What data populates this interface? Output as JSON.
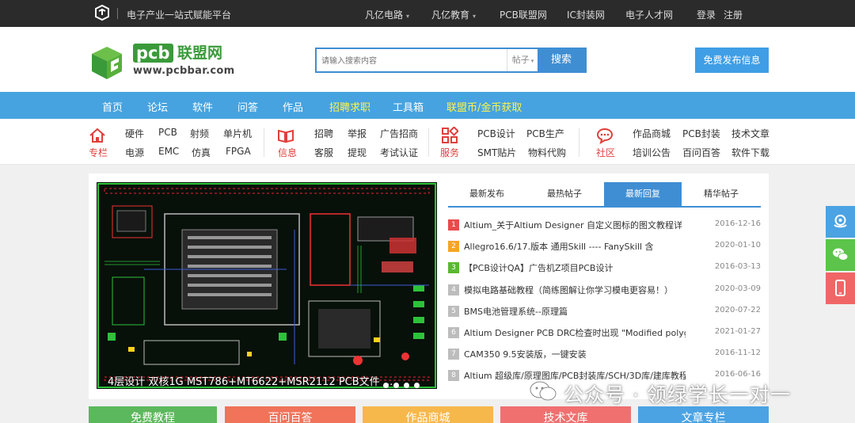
{
  "topbar": {
    "tagline": "电子产业一站式赋能平台",
    "nav": [
      {
        "label": "凡亿电路",
        "caret": "▾"
      },
      {
        "label": "凡亿教育",
        "caret": "▾"
      },
      {
        "label": "PCB联盟网",
        "caret": ""
      },
      {
        "label": "IC封装网",
        "caret": ""
      },
      {
        "label": "电子人才网",
        "caret": ""
      }
    ],
    "login": "登录",
    "register": "注册"
  },
  "header": {
    "logo_pcb": "pcb",
    "logo_name": "联盟网",
    "logo_url": "www.pcbbar.com",
    "search_placeholder": "请输入搜索内容",
    "search_type": "帖子",
    "search_button": "搜索",
    "publish_button": "免费发布信息"
  },
  "mainnav": [
    {
      "label": "首页",
      "highlight": false
    },
    {
      "label": "论坛",
      "highlight": false
    },
    {
      "label": "软件",
      "highlight": false
    },
    {
      "label": "问答",
      "highlight": false
    },
    {
      "label": "作品",
      "highlight": false
    },
    {
      "label": "招聘求职",
      "highlight": true
    },
    {
      "label": "工具箱",
      "highlight": false
    },
    {
      "label": "联盟币/金币获取",
      "highlight": true
    }
  ],
  "categories": [
    {
      "label": "专栏",
      "icon": "home-icon",
      "links": [
        "硬件",
        "PCB",
        "射频",
        "单片机",
        "电源",
        "EMC",
        "仿真",
        "FPGA"
      ]
    },
    {
      "label": "信息",
      "icon": "book-icon",
      "links": [
        "招聘",
        "举报",
        "广告招商",
        "客服",
        "提现",
        "考试认证"
      ]
    },
    {
      "label": "服务",
      "icon": "grid-icon",
      "links": [
        "PCB设计",
        "PCB生产",
        "SMT贴片",
        "物料代购"
      ]
    },
    {
      "label": "社区",
      "icon": "chat-icon",
      "links": [
        "作品商城",
        "PCB封装",
        "技术文章",
        "培训公告",
        "百问百答",
        "软件下载"
      ]
    }
  ],
  "banner": {
    "caption": "4层设计 双核1G MST786+MT6622+MSR2112 PCB文件 ..."
  },
  "tabs": [
    "最新发布",
    "最热帖子",
    "最新回复",
    "精华帖子"
  ],
  "active_tab": 2,
  "posts": [
    {
      "num": "1",
      "title": "Altium_关于Altium Designer 自定义图标的图文教程详",
      "date": "2016-12-16",
      "color": "#e94b4b"
    },
    {
      "num": "2",
      "title": "Allegro16.6/17.版本 通用Skill ---- FanySkill 含",
      "date": "2020-01-10",
      "color": "#f5a623"
    },
    {
      "num": "3",
      "title": "【PCB设计QA】广告机Z项目PCB设计",
      "date": "2016-03-13",
      "color": "#5cb82e"
    },
    {
      "num": "4",
      "title": "模拟电路基础教程（简练图解让你学习模电更容易！）",
      "date": "2020-03-09",
      "color": "#bdbdbd"
    },
    {
      "num": "5",
      "title": "BMS电池管理系统--原理篇",
      "date": "2020-07-22",
      "color": "#bdbdbd"
    },
    {
      "num": "6",
      "title": "Altium Designer PCB DRC检查时出现 \"Modified polygo",
      "date": "2021-01-27",
      "color": "#bdbdbd"
    },
    {
      "num": "7",
      "title": "CAM350 9.5安装版，一键安装",
      "date": "2016-11-12",
      "color": "#bdbdbd"
    },
    {
      "num": "8",
      "title": "Altium 超级库/原理图库/PCB封装库/SCH/3D库/建库教程",
      "date": "2016-06-16",
      "color": "#bdbdbd"
    }
  ],
  "bottom_buttons": [
    {
      "label": "免费教程",
      "color": "#5cb85c"
    },
    {
      "label": "百问百答",
      "color": "#f0735a"
    },
    {
      "label": "作品商城",
      "color": "#f7b84b"
    },
    {
      "label": "技术文库",
      "color": "#f07070"
    },
    {
      "label": "文章专栏",
      "color": "#4ba3e3"
    }
  ],
  "watermark": "公众号 · 领绿学长一对一",
  "colors": {
    "topbar": "#2b2b2b",
    "brand_green": "#3a9a3a",
    "nav_blue": "#46a3e0",
    "accent_blue": "#3f8ed3",
    "category_red": "#e0403b",
    "nav_highlight": "#fff34d"
  }
}
